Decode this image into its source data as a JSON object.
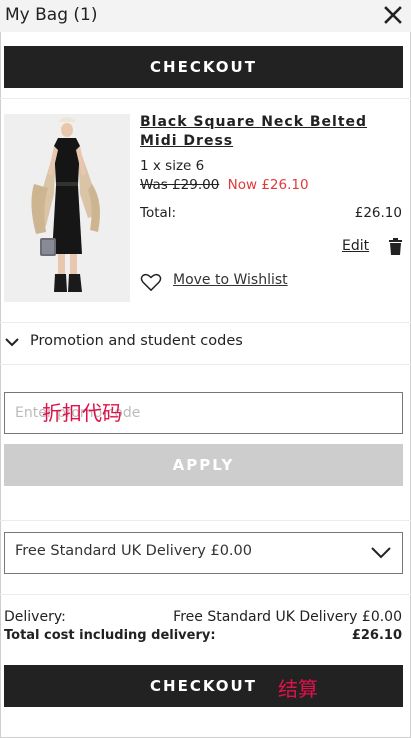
{
  "header": {
    "title": "My Bag (1)"
  },
  "buttons": {
    "checkout_top": "CHECKOUT",
    "checkout_bottom": "CHECKOUT",
    "apply": "APPLY"
  },
  "item": {
    "name": "Black Square Neck Belted Midi Dress",
    "quantity_size": "1 x size 6",
    "was_price": "Was £29.00",
    "now_price": "Now £26.10",
    "total_label": "Total:",
    "total_value": "£26.10",
    "edit_label": "Edit",
    "wishlist_label": "Move to Wishlist"
  },
  "promo": {
    "toggle_label": "Promotion and student codes",
    "input_placeholder": "Enter promo code",
    "annotation": "折扣代码"
  },
  "delivery": {
    "selected_option": "Free Standard UK Delivery £0.00"
  },
  "summary": {
    "delivery_label": "Delivery:",
    "delivery_value": "Free Standard UK Delivery £0.00",
    "total_label": "Total cost including delivery:",
    "total_value": "£26.10"
  },
  "annotations": {
    "checkout": "结算"
  },
  "icons": [
    "close-icon",
    "trash-icon",
    "heart-icon",
    "chevron-down-icon"
  ],
  "colors": {
    "dark_button": "#222222",
    "sale_price": "#e13a3a",
    "apply_disabled": "#cdcdcd",
    "annotation": "#e0104a"
  }
}
